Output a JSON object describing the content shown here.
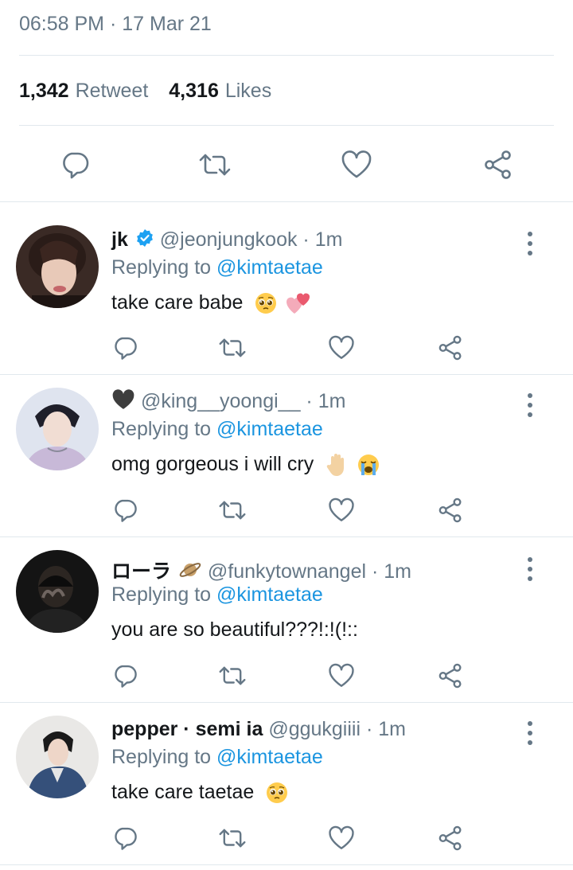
{
  "tweet": {
    "time": "06:58 PM",
    "sep": " · ",
    "date": "17 Mar 21",
    "retweet_count": "1,342",
    "retweet_label": "Retweet",
    "likes_count": "4,316",
    "likes_label": "Likes"
  },
  "icons": {
    "reply": "reply-icon",
    "retweet": "retweet-icon",
    "like": "heart-icon",
    "share": "share-icon",
    "more": "more-vertical-icon",
    "verified": "verified-badge-icon"
  },
  "colors": {
    "text": "#14171a",
    "muted": "#657786",
    "link": "#1b95e0",
    "divider": "#e1e8ed",
    "verified": "#1da1f2"
  },
  "replies": [
    {
      "name": "jk",
      "verified": true,
      "handle": "@jeonjungkook",
      "time": " · 1m",
      "replying_prefix": "Replying to ",
      "replying_to": "@kimtaetae",
      "text": "take care babe",
      "emojis": [
        "pleading-face",
        "two-hearts"
      ]
    },
    {
      "name": "",
      "name_emoji": "black-heart",
      "handle": "@king__yoongi__",
      "time": " · 1m",
      "replying_prefix": "Replying to ",
      "replying_to": "@kimtaetae",
      "text": "omg gorgeous i will cry",
      "emojis": [
        "raised-hand",
        "loudly-crying-face"
      ]
    },
    {
      "name": "ローラ",
      "name_emoji": "ringed-planet",
      "handle": "@funkytownangel",
      "time": " · 1m",
      "replying_prefix": "Replying to ",
      "replying_to": "@kimtaetae",
      "text": "you are so beautiful???!:!(!::",
      "emojis": []
    },
    {
      "name": "pepper · semi ia",
      "handle": "@ggukgiiii",
      "time": " · 1m",
      "replying_prefix": "Replying to ",
      "replying_to": "@kimtaetae",
      "text": "take care taetae",
      "emojis": [
        "pleading-face"
      ]
    }
  ]
}
